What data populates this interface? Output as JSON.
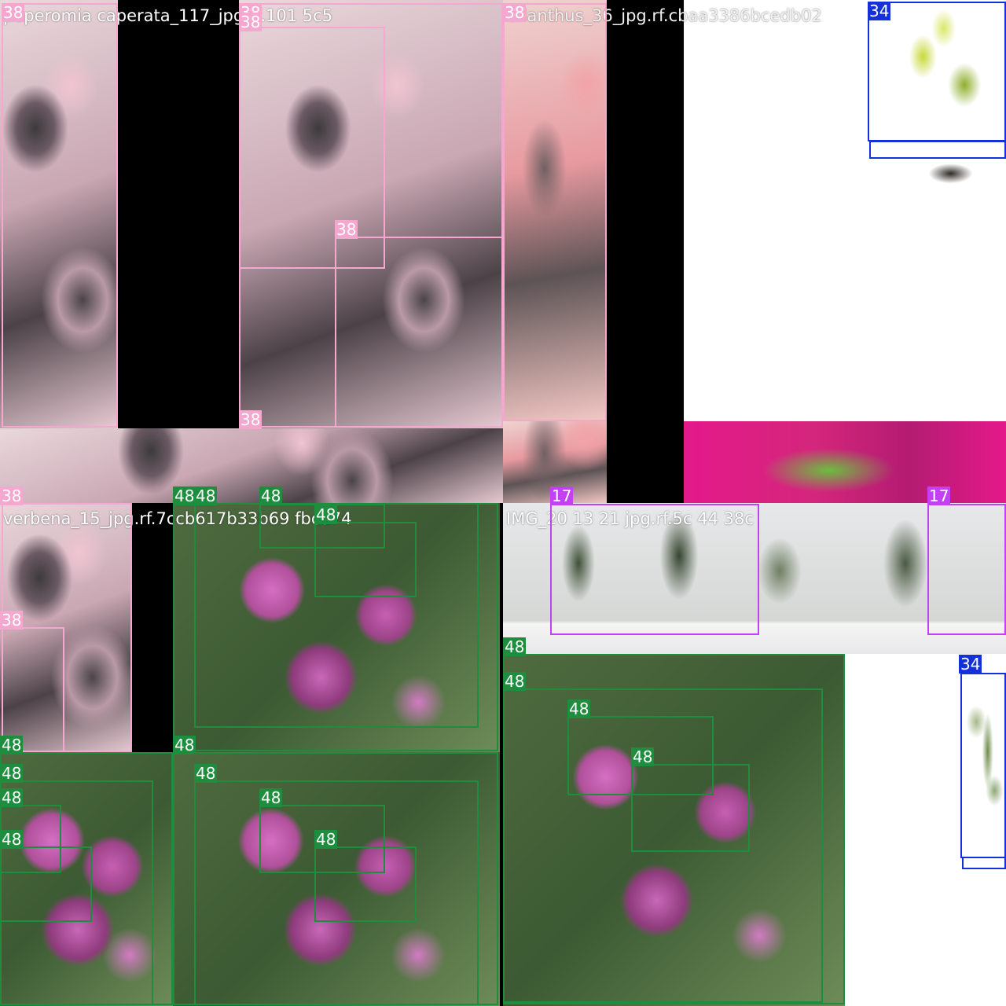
{
  "colors": {
    "class_38": "#f4a7cf",
    "class_48": "#1e8e3e",
    "class_17": "#c440f4",
    "class_34": "#1430d8"
  },
  "captions": {
    "peperomia": "peperomia caperata_117_jpg.rf.101 5c5",
    "ailanthus": "ailanthus_36_jpg.rf.cbaa3386bcedb02",
    "verbena": "verbena_15_jpg.rf.7ccb617b33b69 fbcd74",
    "img": "IMG_20 13 21 jpg.rf.5c 44 38c"
  },
  "labels": {
    "l38": "38",
    "l48": "48",
    "l17": "17",
    "l34": "34"
  }
}
